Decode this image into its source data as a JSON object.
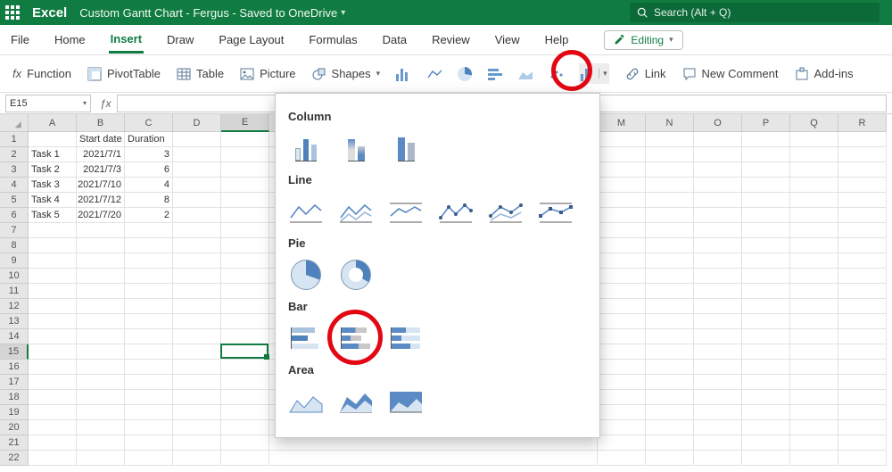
{
  "title_bar": {
    "app": "Excel",
    "doc": "Custom Gantt Chart - Fergus  -  Saved to OneDrive"
  },
  "search": {
    "placeholder": "Search (Alt + Q)"
  },
  "tabs": {
    "file": "File",
    "home": "Home",
    "insert": "Insert",
    "draw": "Draw",
    "page_layout": "Page Layout",
    "formulas": "Formulas",
    "data": "Data",
    "review": "Review",
    "view": "View",
    "help": "Help",
    "editing": "Editing"
  },
  "cmds": {
    "fx": "fx",
    "function": "Function",
    "pivot": "PivotTable",
    "table": "Table",
    "picture": "Picture",
    "shapes": "Shapes",
    "link": "Link",
    "comment": "New Comment",
    "addins": "Add-ins"
  },
  "name_box": "E15",
  "columns": [
    "A",
    "B",
    "C",
    "D",
    "E",
    "M",
    "N",
    "O",
    "P",
    "Q",
    "R"
  ],
  "rows_visible": 22,
  "sheet": {
    "headers": {
      "A": "",
      "B": "Start date",
      "C": "Duration"
    },
    "data": [
      {
        "A": "Task 1",
        "B": "2021/7/1",
        "C": "3"
      },
      {
        "A": "Task 2",
        "B": "2021/7/3",
        "C": "6"
      },
      {
        "A": "Task 3",
        "B": "2021/7/10",
        "C": "4"
      },
      {
        "A": "Task 4",
        "B": "2021/7/12",
        "C": "8"
      },
      {
        "A": "Task 5",
        "B": "2021/7/20",
        "C": "2"
      }
    ]
  },
  "selected_cell": {
    "row": 15,
    "col": "E"
  },
  "chart_panel": {
    "column": "Column",
    "line": "Line",
    "pie": "Pie",
    "bar": "Bar",
    "area": "Area"
  }
}
